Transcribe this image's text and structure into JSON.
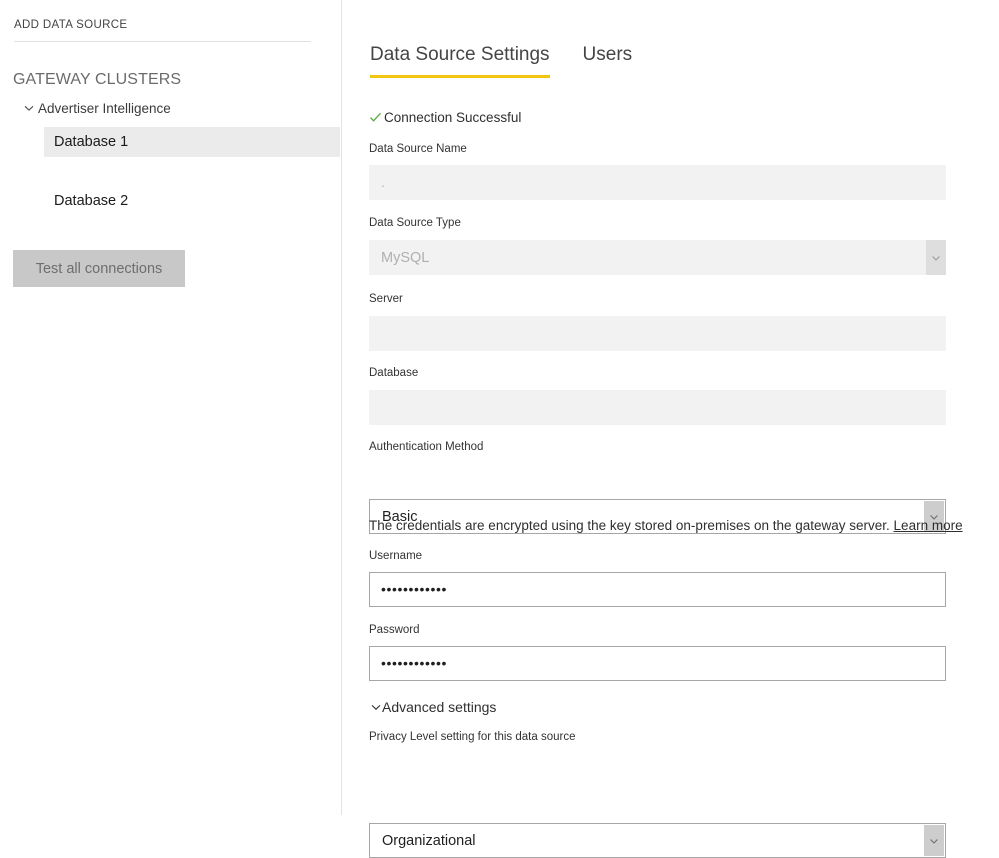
{
  "sidebar": {
    "add_data_source_label": "ADD DATA SOURCE",
    "section_title": "GATEWAY CLUSTERS",
    "cluster": {
      "name": "Advertiser Intelligence",
      "chevron_icon": "chevron-down-icon",
      "expanded": true,
      "data_sources": [
        {
          "label": "Database 1",
          "selected": true
        },
        {
          "label": "Database 2",
          "selected": false
        }
      ]
    },
    "test_all_connections_label": "Test all connections"
  },
  "main": {
    "tabs": [
      {
        "label": "Data Source Settings",
        "active": true
      },
      {
        "label": "Users",
        "active": false
      }
    ],
    "connection_status": {
      "icon": "check-icon",
      "text": "Connection Successful",
      "color": "#5aab3f"
    },
    "fields": {
      "data_source_name": {
        "label": "Data Source Name",
        "value": ".",
        "placeholder": "",
        "disabled": true
      },
      "data_source_type": {
        "label": "Data Source Type",
        "value": "MySQL",
        "disabled": true,
        "arrow_icon": "chevron-down-icon"
      },
      "server": {
        "label": "Server",
        "value": "",
        "placeholder": "",
        "disabled": true
      },
      "database": {
        "label": "Database",
        "value": "",
        "placeholder": "",
        "disabled": true
      },
      "authentication_method": {
        "label": "Authentication Method",
        "value": "Basic",
        "disabled": false,
        "arrow_icon": "chevron-down-icon"
      },
      "username": {
        "label": "Username",
        "value": "••••••••••••",
        "disabled": false
      },
      "password": {
        "label": "Password",
        "value": "••••••••••••",
        "disabled": false
      },
      "privacy_level": {
        "label": "Privacy Level setting for this data source",
        "value": "Organizational",
        "disabled": false,
        "arrow_icon": "chevron-down-icon"
      }
    },
    "credentials_note": {
      "text": "The credentials are encrypted using the key stored on-premises on the gateway server.",
      "link_label": "Learn more"
    },
    "advanced_settings": {
      "label": "Advanced settings",
      "chevron_icon": "chevron-down-icon",
      "expanded": true
    }
  },
  "colors": {
    "accent": "#f2c60f",
    "success": "#5aab3f",
    "disabled_field_bg": "#f2f2f2",
    "selected_item_bg": "#ebebeb"
  }
}
